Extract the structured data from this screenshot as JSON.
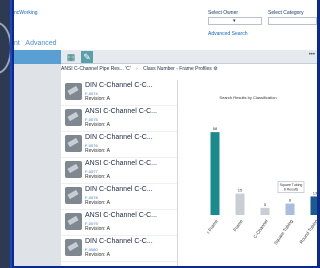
{
  "header": {
    "brand_link": "ncWorking",
    "find_owner_label": "Select Owner",
    "category_label": "Select Category",
    "advanced_search_link": "Advanced Search",
    "tabs": [
      "nt",
      "Advanced"
    ]
  },
  "breadcrumb": {
    "item1": "ANSI C-Channel Pipe Res... 'C'",
    "item2": "Class Number - Frame Profiles"
  },
  "items": [
    {
      "title": "DIN C-Channel C-C...",
      "number": "F-0074",
      "revision": "Revision: A"
    },
    {
      "title": "ANSI C-Channel C-C...",
      "number": "F-0075",
      "revision": "Revision: A"
    },
    {
      "title": "DIN C-Channel C-C...",
      "number": "F-0076",
      "revision": "Revision: A"
    },
    {
      "title": "ANSI C-Channel C-C...",
      "number": "F-0077",
      "revision": "Revision: A"
    },
    {
      "title": "DIN C-Channel C-C...",
      "number": "F-0078",
      "revision": "Revision: A"
    },
    {
      "title": "ANSI C-Channel C-C...",
      "number": "F-0079",
      "revision": "Revision: A"
    },
    {
      "title": "DIN C-Channel C-C...",
      "number": "F-0080",
      "revision": "Revision: A"
    }
  ],
  "colors": {
    "accent": "#5a9fd4",
    "teal": "#1b8a8f"
  },
  "chart_data": {
    "type": "bar",
    "title": "Search Results by Classification",
    "categories": [
      "r Frame",
      "Frame",
      "C-Channel",
      "Square Tubing",
      "Round Tubing"
    ],
    "values": [
      58,
      15,
      5,
      8,
      13
    ],
    "value_labels": [
      "58",
      "15",
      "5",
      "8",
      "13"
    ],
    "colors": [
      "#1b8a8f",
      "#c9cdd4",
      "#c9cdd4",
      "#a9bde0",
      "#1b5a8f"
    ],
    "ylim": [
      0,
      70
    ],
    "tooltip": [
      "Square Tubing",
      "8 Results"
    ]
  }
}
